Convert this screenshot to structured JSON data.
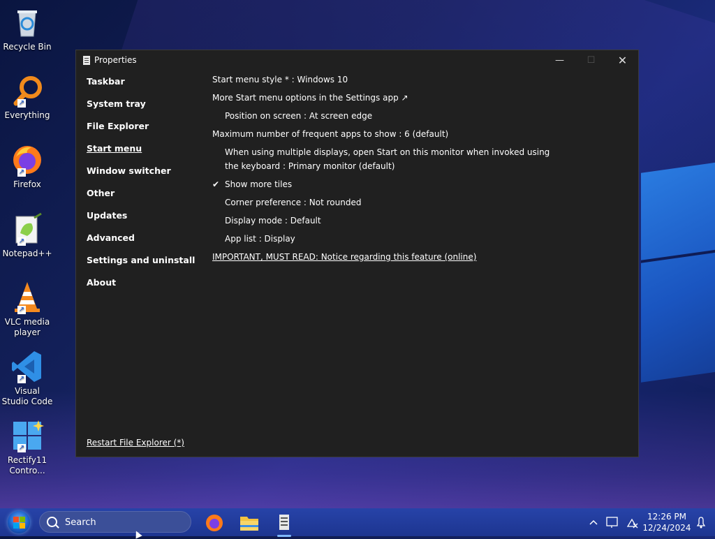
{
  "desktop": {
    "icons": [
      {
        "label": "Recycle Bin"
      },
      {
        "label": "Everything"
      },
      {
        "label": "Firefox"
      },
      {
        "label": "Notepad++"
      },
      {
        "label": "VLC media player"
      },
      {
        "label": "Visual Studio Code"
      },
      {
        "label": "Rectify11 Contro..."
      }
    ]
  },
  "window": {
    "title": "Properties",
    "controls": {
      "minimize": "—",
      "maximize": "☐",
      "close": "✕"
    },
    "nav": [
      {
        "label": "Taskbar"
      },
      {
        "label": "System tray"
      },
      {
        "label": "File Explorer"
      },
      {
        "label": "Start menu",
        "active": true
      },
      {
        "label": "Window switcher"
      },
      {
        "label": "Other"
      },
      {
        "label": "Updates"
      },
      {
        "label": "Advanced"
      },
      {
        "label": "Settings and uninstall"
      },
      {
        "label": "About"
      }
    ],
    "restart_link": "Restart File Explorer (*)",
    "settings": {
      "start_menu_style": "Start menu style * : Windows 10",
      "more_options": "More Start menu options in the Settings app ↗",
      "position": "Position on screen : At screen edge",
      "max_frequent": "Maximum number of frequent apps to show : 6 (default)",
      "multi_display_line1": "When using multiple displays, open Start on this monitor when invoked using",
      "multi_display_line2": "the keyboard : Primary monitor (default)",
      "show_more_tiles": "Show more tiles",
      "show_more_tiles_check": "✔",
      "corner_preference": "Corner preference : Not rounded",
      "display_mode": "Display mode : Default",
      "app_list": "App list : Display",
      "important_notice": "IMPORTANT, MUST READ: Notice regarding this feature (online)"
    }
  },
  "taskbar": {
    "search_placeholder": "Search",
    "clock_time": "12:26 PM",
    "clock_date": "12/24/2024",
    "tray_chevron": "^"
  }
}
